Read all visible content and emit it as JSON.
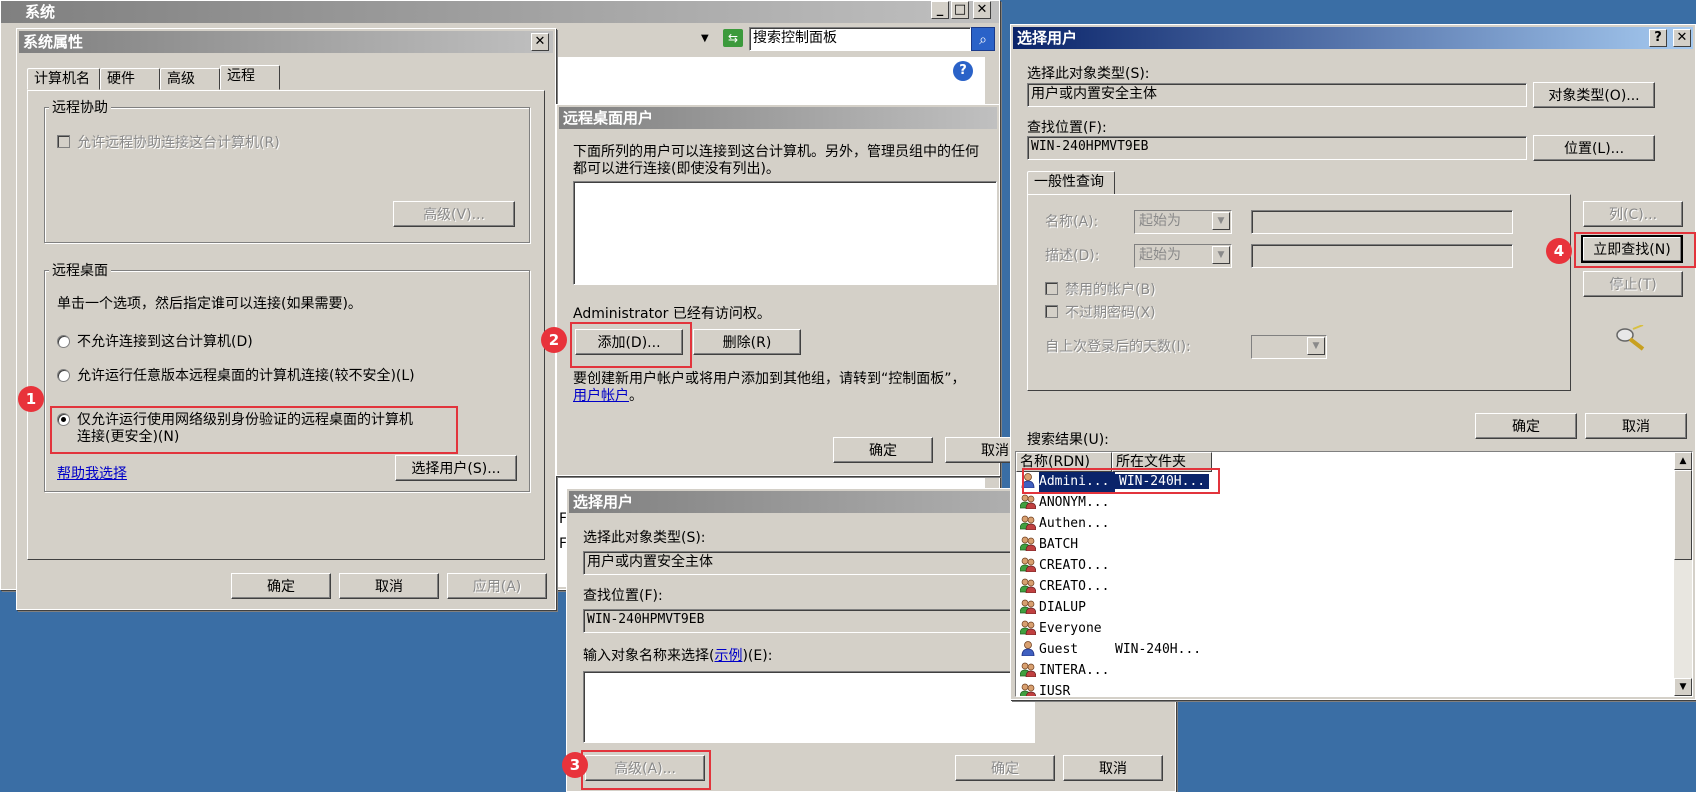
{
  "bg_window": {
    "title": "系统",
    "search_placeholder": "搜索控制面板",
    "partial_texts": [
      "F",
      "F"
    ]
  },
  "sys_props": {
    "title": "系统属性",
    "tabs": [
      {
        "label": "计算机名"
      },
      {
        "label": "硬件"
      },
      {
        "label": "高级"
      },
      {
        "label": "远程"
      }
    ],
    "remote_assist": {
      "group_label": "远程协助",
      "checkbox_label": "允许远程协助连接这台计算机(R)",
      "advanced_button": "高级(V)..."
    },
    "remote_desktop": {
      "group_label": "远程桌面",
      "hint": "单击一个选项，然后指定谁可以连接(如果需要)。",
      "option1": "不允许连接到这台计算机(D)",
      "option2": "允许运行任意版本远程桌面的计算机连接(较不安全)(L)",
      "option3_line1": "仅允许运行使用网络级别身份验证的远程桌面的计算机",
      "option3_line2": "连接(更安全)(N)",
      "help_link": "帮助我选择",
      "select_users_button": "选择用户(S)..."
    },
    "ok": "确定",
    "cancel": "取消",
    "apply": "应用(A)"
  },
  "rd_users": {
    "title": "远程桌面用户",
    "desc_line1": "下面所列的用户可以连接到这台计算机。另外，管理员组中的任何",
    "desc_line2": "都可以进行连接(即使没有列出)。",
    "access_text": "Administrator 已经有访问权。",
    "add_button": "添加(D)...",
    "remove_button": "删除(R)",
    "create_line1": "要创建新用户帐户或将用户添加到其他组，请转到“控制面板”，",
    "create_link": "用户帐户",
    "create_line2_suffix": "。",
    "ok": "确定",
    "cancel": "取消"
  },
  "select_users_small": {
    "title": "选择用户",
    "object_type_label": "选择此对象类型(S):",
    "object_type_value": "用户或内置安全主体",
    "location_label": "查找位置(F):",
    "location_value": "WIN-240HPMVT9EB",
    "enter_label_pre": "输入对象名称来选择(",
    "enter_label_link": "示例",
    "enter_label_post": ")(E):",
    "advanced_button": "高级(A)...",
    "ok": "确定",
    "cancel": "取消"
  },
  "select_users_adv": {
    "title": "选择用户",
    "object_type_label": "选择此对象类型(S):",
    "object_type_value": "用户或内置安全主体",
    "object_types_button": "对象类型(O)...",
    "location_label": "查找位置(F):",
    "location_value": "WIN-240HPMVT9EB",
    "locations_button": "位置(L)...",
    "common_queries_tab": "一般性查询",
    "name_label": "名称(A):",
    "desc_label": "描述(D):",
    "starts_with": "起始为",
    "disabled_accounts": "禁用的帐户(B)",
    "non_expiring": "不过期密码(X)",
    "days_since_logon": "自上次登录后的天数(I):",
    "columns_button": "列(C)...",
    "find_now_button": "立即查找(N)",
    "stop_button": "停止(T)",
    "ok": "确定",
    "cancel": "取消",
    "results_label": "搜索结果(U):",
    "col_name": "名称(RDN)",
    "col_folder": "所在文件夹",
    "results": [
      {
        "name": "Admini...",
        "folder": "WIN-240H..."
      },
      {
        "name": "ANONYM...",
        "folder": ""
      },
      {
        "name": "Authen...",
        "folder": ""
      },
      {
        "name": "BATCH",
        "folder": ""
      },
      {
        "name": "CREATO...",
        "folder": ""
      },
      {
        "name": "CREATO...",
        "folder": ""
      },
      {
        "name": "DIALUP",
        "folder": ""
      },
      {
        "name": "Everyone",
        "folder": ""
      },
      {
        "name": "Guest",
        "folder": "WIN-240H..."
      },
      {
        "name": "INTERA...",
        "folder": ""
      },
      {
        "name": "IUSR",
        "folder": ""
      }
    ]
  },
  "annotations": {
    "step1": "1",
    "step2": "2",
    "step3": "3",
    "step4": "4"
  },
  "colors": {
    "desktop": "#3a6ea5",
    "title_active": "#0a246a",
    "annotation_red": "#e2343c",
    "selection": "#0a246a"
  }
}
